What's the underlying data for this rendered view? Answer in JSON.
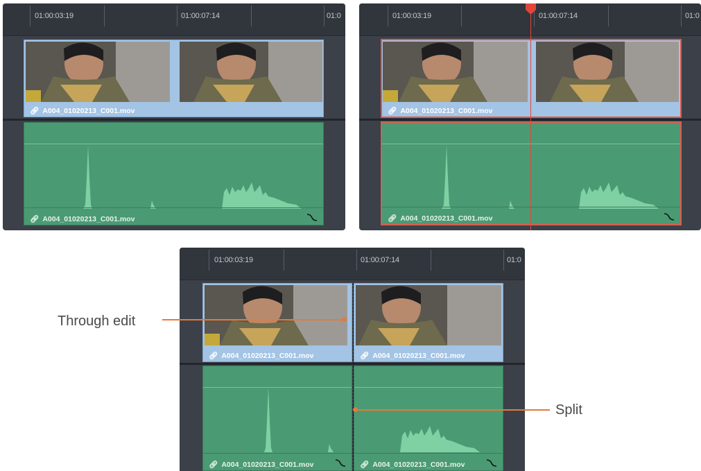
{
  "colors": {
    "video_clip": "#a3c4e4",
    "audio_clip": "#4a9a74",
    "selection": "#e25a4d",
    "annotation": "#e47a3a",
    "panel_bg": "#3c4048"
  },
  "panels": [
    {
      "timecodes": [
        "01:00:03:19",
        "01:00:07:14",
        "01:0"
      ]
    },
    {
      "timecodes": [
        "01:00:03:19",
        "01:00:07:14",
        "01:0"
      ]
    },
    {
      "timecodes": [
        "01:00:03:19",
        "01:00:07:14",
        "01:0"
      ]
    }
  ],
  "clip_name": "A004_01020213_C001.mov",
  "icons": {
    "link": "link-icon",
    "fade": "fade-handle-icon"
  },
  "annotations": {
    "through_edit": "Through edit",
    "split": "Split"
  }
}
